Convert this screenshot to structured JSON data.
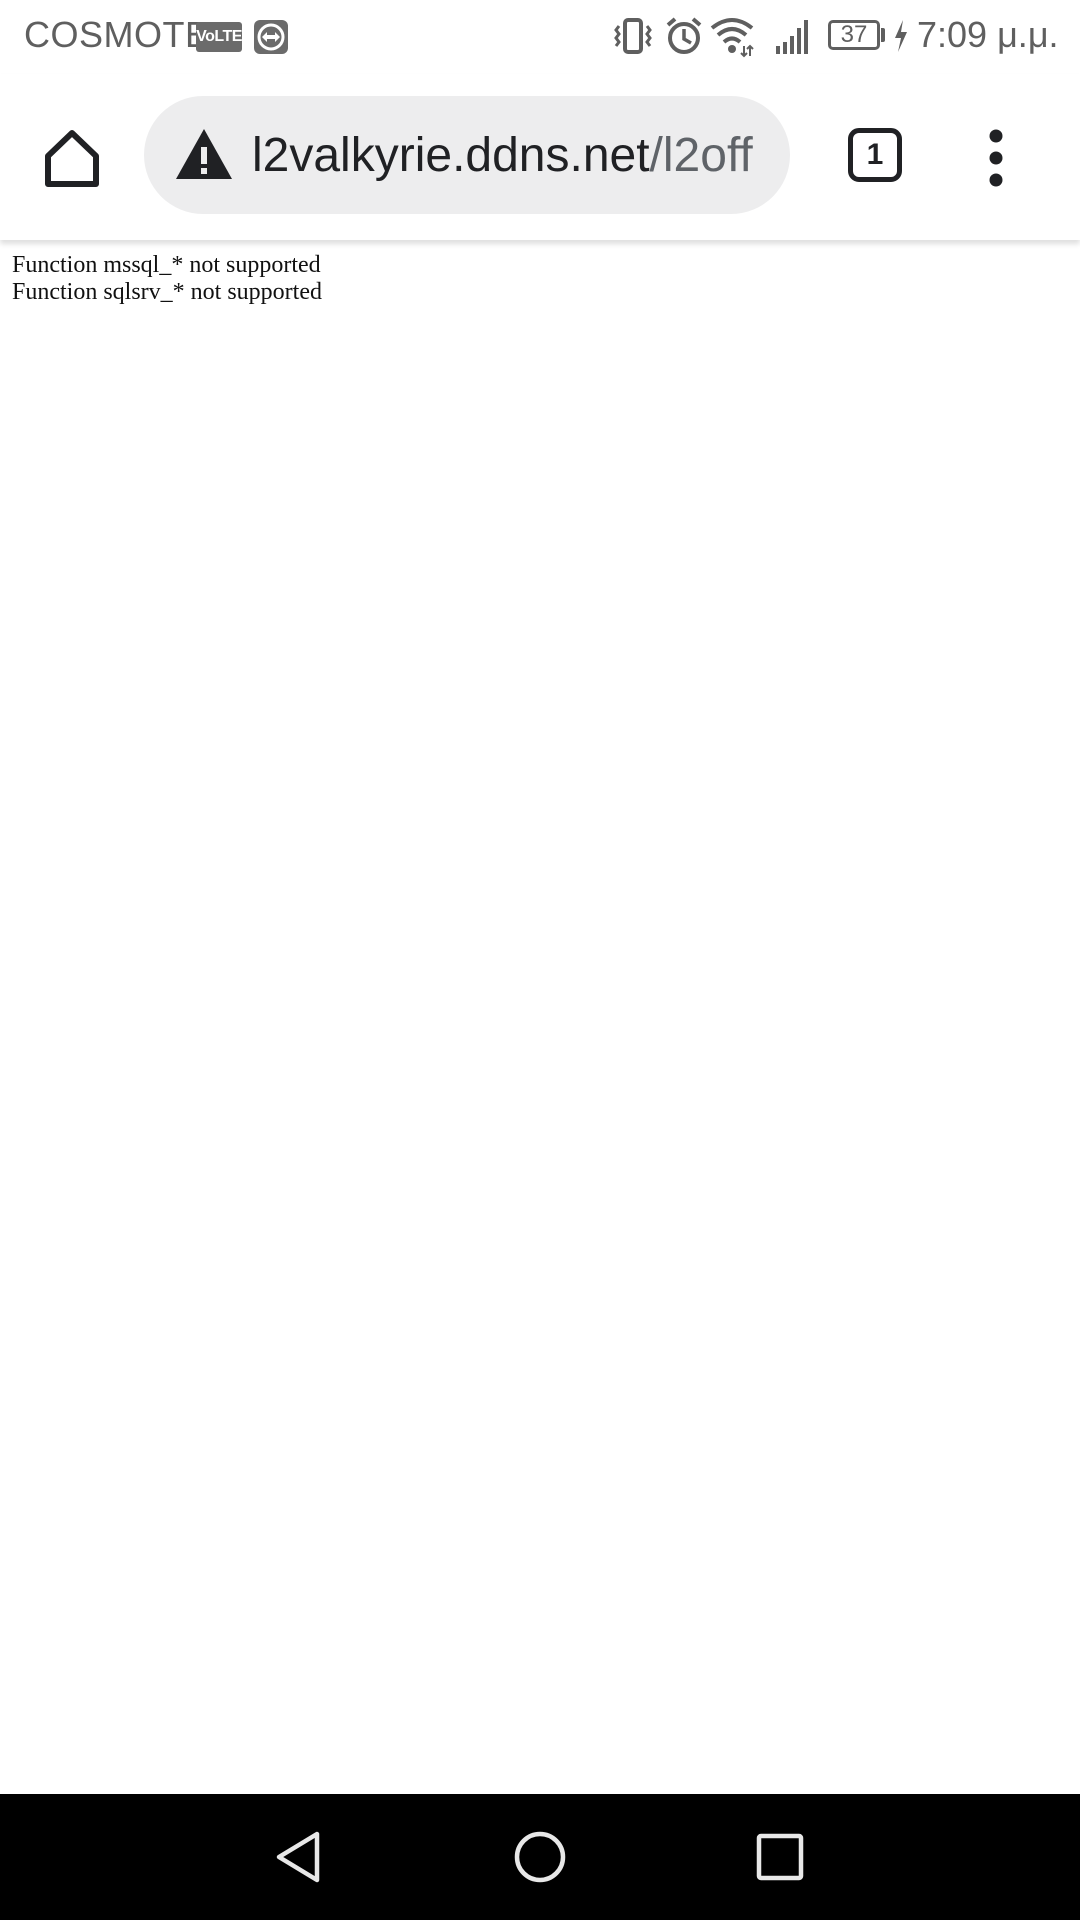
{
  "status_bar": {
    "carrier": "COSMOTE",
    "volte_label": "VoLTE",
    "battery_level": "37",
    "time": "7:09 μ.μ."
  },
  "toolbar": {
    "url_host": "l2valkyrie.ddns.net",
    "url_path": "/l2off",
    "tab_count": "1",
    "icons": [
      "home-icon",
      "warning-icon",
      "tab-switcher-icon",
      "more-vert-icon"
    ]
  },
  "page": {
    "lines": [
      "Function mssql_* not supported",
      "Function sqlsrv_* not supported"
    ]
  },
  "nav_bar": {
    "icons": [
      "back-icon",
      "home-circle-icon",
      "recents-icon"
    ]
  },
  "colors": {
    "status_text": "#5f5f5f",
    "omnibox_bg": "#ededee",
    "nav_bar_bg": "#000000"
  }
}
